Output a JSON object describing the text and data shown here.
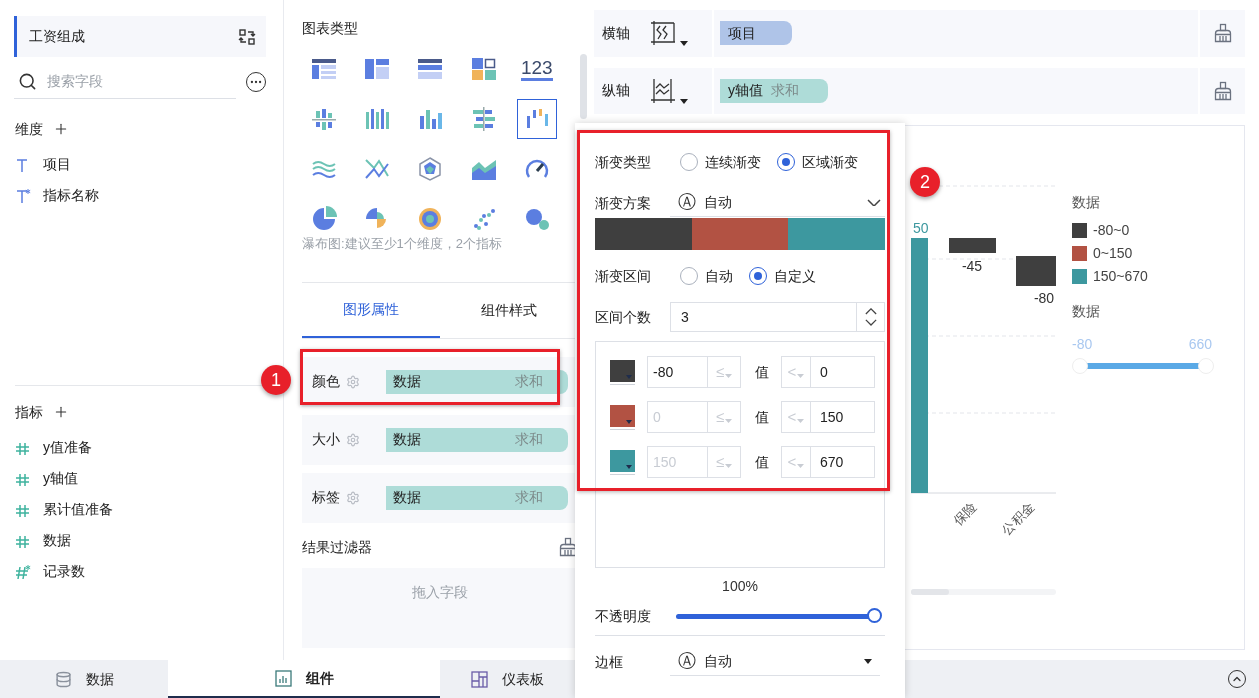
{
  "left_panel": {
    "dataset": {
      "title": "工资组成"
    },
    "search": {
      "placeholder": "搜索字段"
    },
    "sections": [
      {
        "kind": "dimension",
        "title": "维度",
        "items": [
          {
            "label": "项目",
            "derived": false
          },
          {
            "label": "指标名称",
            "derived": true
          }
        ]
      },
      {
        "kind": "measure",
        "title": "指标",
        "items": [
          {
            "label": "y值准备",
            "derived": false
          },
          {
            "label": "y轴值",
            "derived": false
          },
          {
            "label": "累计值准备",
            "derived": false
          },
          {
            "label": "数据",
            "derived": false
          },
          {
            "label": "记录数",
            "derived": true
          }
        ]
      }
    ]
  },
  "chart_panel": {
    "title": "图表类型",
    "chart_types": [
      {
        "kind": "table",
        "selected": false
      },
      {
        "kind": "pivot",
        "selected": false
      },
      {
        "kind": "detail",
        "selected": false
      },
      {
        "kind": "tiles",
        "selected": false
      },
      {
        "kind": "number",
        "text": "123",
        "selected": false
      },
      {
        "kind": "dotbar",
        "selected": false
      },
      {
        "kind": "groupbar",
        "selected": false
      },
      {
        "kind": "bar",
        "selected": false
      },
      {
        "kind": "hbar",
        "selected": false
      },
      {
        "kind": "waterfall",
        "selected": true
      },
      {
        "kind": "wave",
        "selected": false
      },
      {
        "kind": "line",
        "selected": false
      },
      {
        "kind": "radar",
        "selected": false
      },
      {
        "kind": "area",
        "selected": false
      },
      {
        "kind": "gauge",
        "selected": false
      },
      {
        "kind": "pie",
        "selected": false
      },
      {
        "kind": "rose",
        "selected": false
      },
      {
        "kind": "sunburst",
        "selected": false
      },
      {
        "kind": "scatter",
        "selected": false
      },
      {
        "kind": "bubble",
        "selected": false
      }
    ],
    "hint": "瀑布图:建议至少1个维度，2个指标",
    "tabs": [
      {
        "label": "图形属性",
        "selected": true
      },
      {
        "label": "组件样式",
        "selected": false
      }
    ],
    "properties": [
      {
        "label": "颜色",
        "field": "数据",
        "aggregation": "求和"
      },
      {
        "label": "大小",
        "field": "数据",
        "aggregation": "求和"
      },
      {
        "label": "标签",
        "field": "数据",
        "aggregation": "求和"
      }
    ],
    "filter": {
      "title": "结果过滤器",
      "drop_hint": "拖入字段"
    }
  },
  "axes": [
    {
      "label": "横轴",
      "chips": [
        {
          "kind": "dimension",
          "label": "项目"
        }
      ]
    },
    {
      "label": "纵轴",
      "chips": [
        {
          "kind": "measure",
          "label": "y轴值",
          "aggregation": "求和"
        }
      ]
    }
  ],
  "chart": {
    "value_labels": [
      "50",
      "-45",
      "-80"
    ],
    "categories": [
      "保险",
      "公积金"
    ],
    "legend": {
      "title": "数据",
      "items": [
        {
          "label": "-80~0",
          "color": "#3f3f3f"
        },
        {
          "label": "0~150",
          "color": "#b25243"
        },
        {
          "label": "150~670",
          "color": "#3d989f"
        }
      ]
    },
    "range_legend": {
      "title": "数据",
      "min": "-80",
      "max": "660",
      "level": 1
    }
  },
  "color_popover": {
    "type": {
      "label": "渐变类型",
      "options": [
        {
          "label": "连续渐变",
          "selected": false
        },
        {
          "label": "区域渐变",
          "selected": true
        }
      ]
    },
    "scheme": {
      "label": "渐变方案",
      "icon": "Ⓐ",
      "value": "自动"
    },
    "scheme_colors": [
      {
        "color": "#3f3f3f"
      },
      {
        "color": "#b25243"
      },
      {
        "color": "#3d989f"
      }
    ],
    "range_mode": {
      "label": "渐变区间",
      "options": [
        {
          "label": "自动",
          "selected": false
        },
        {
          "label": "自定义",
          "selected": true
        }
      ]
    },
    "count": {
      "label": "区间个数",
      "value": "3"
    },
    "ranges": [
      {
        "color": "#3f3f3f",
        "from": "-80",
        "disabled": false,
        "lower_sign": "≤",
        "value_label": "值",
        "upper_sign": "<",
        "to": "0"
      },
      {
        "color": "#b25243",
        "from": "0",
        "disabled": true,
        "lower_sign": "≤",
        "value_label": "值",
        "upper_sign": "<",
        "to": "150"
      },
      {
        "color": "#3d989f",
        "from": "150",
        "disabled": true,
        "lower_sign": "≤",
        "value_label": "值",
        "upper_sign": "<",
        "to": "670"
      }
    ],
    "opacity_reading": "100%",
    "opacity": {
      "label": "不透明度",
      "level": 1
    },
    "border": {
      "label": "边框",
      "icon": "Ⓐ",
      "value": "自动"
    }
  },
  "bottom_tabs": [
    {
      "kind": "data",
      "label": "数据",
      "selected": false
    },
    {
      "kind": "component",
      "label": "组件",
      "selected": true
    },
    {
      "kind": "dashboard",
      "label": "仪表板",
      "selected": false
    }
  ],
  "annotations": [
    {
      "label": "1"
    },
    {
      "label": "2"
    }
  ]
}
